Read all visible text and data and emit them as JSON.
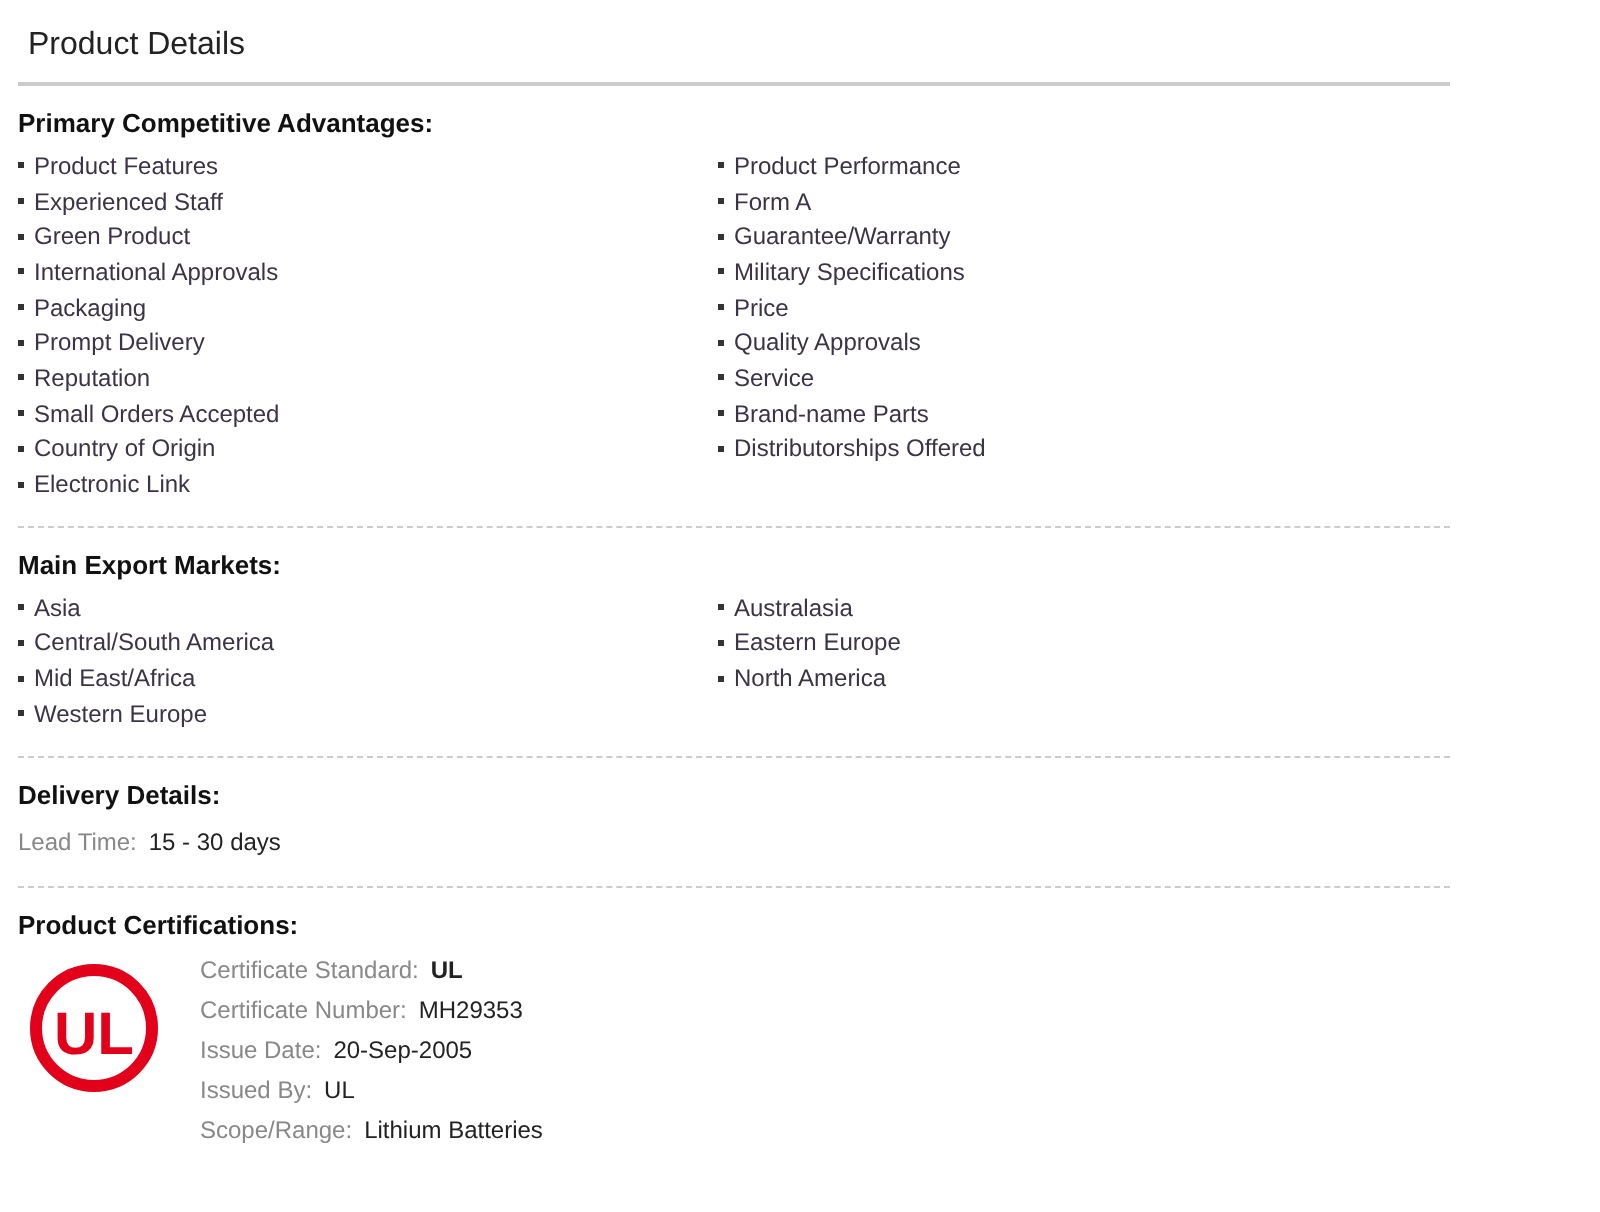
{
  "title": "Product Details",
  "sections": [
    {
      "kind": "list",
      "heading": "Primary Competitive Advantages:",
      "columns": [
        [
          "Product Features",
          "Experienced Staff",
          "Green Product",
          "International Approvals",
          "Packaging",
          "Prompt Delivery",
          "Reputation",
          "Small Orders Accepted",
          "Country of Origin",
          "Electronic Link"
        ],
        [
          "Product Performance",
          "Form A",
          "Guarantee/Warranty",
          "Military Specifications",
          "Price",
          "Quality Approvals",
          "Service",
          "Brand-name Parts",
          "Distributorships Offered"
        ]
      ]
    },
    {
      "kind": "list",
      "heading": "Main Export Markets:",
      "columns": [
        [
          "Asia",
          "Central/South America",
          "Mid East/Africa",
          "Western Europe"
        ],
        [
          "Australasia",
          "Eastern Europe",
          "North America"
        ]
      ]
    },
    {
      "kind": "fields",
      "heading": "Delivery Details:",
      "fields": [
        {
          "label": "Lead Time:",
          "value": "15 - 30 days"
        }
      ]
    },
    {
      "kind": "certificate",
      "heading": "Product Certifications:",
      "logo": "UL",
      "fields": [
        {
          "label": "Certificate Standard:",
          "value": "UL",
          "bold": true
        },
        {
          "label": "Certificate Number:",
          "value": "MH29353",
          "bold": false
        },
        {
          "label": "Issue Date:",
          "value": "20-Sep-2005",
          "bold": false
        },
        {
          "label": "Issued By:",
          "value": "UL",
          "bold": false
        },
        {
          "label": "Scope/Range:",
          "value": "Lithium Batteries",
          "bold": false
        }
      ]
    }
  ]
}
